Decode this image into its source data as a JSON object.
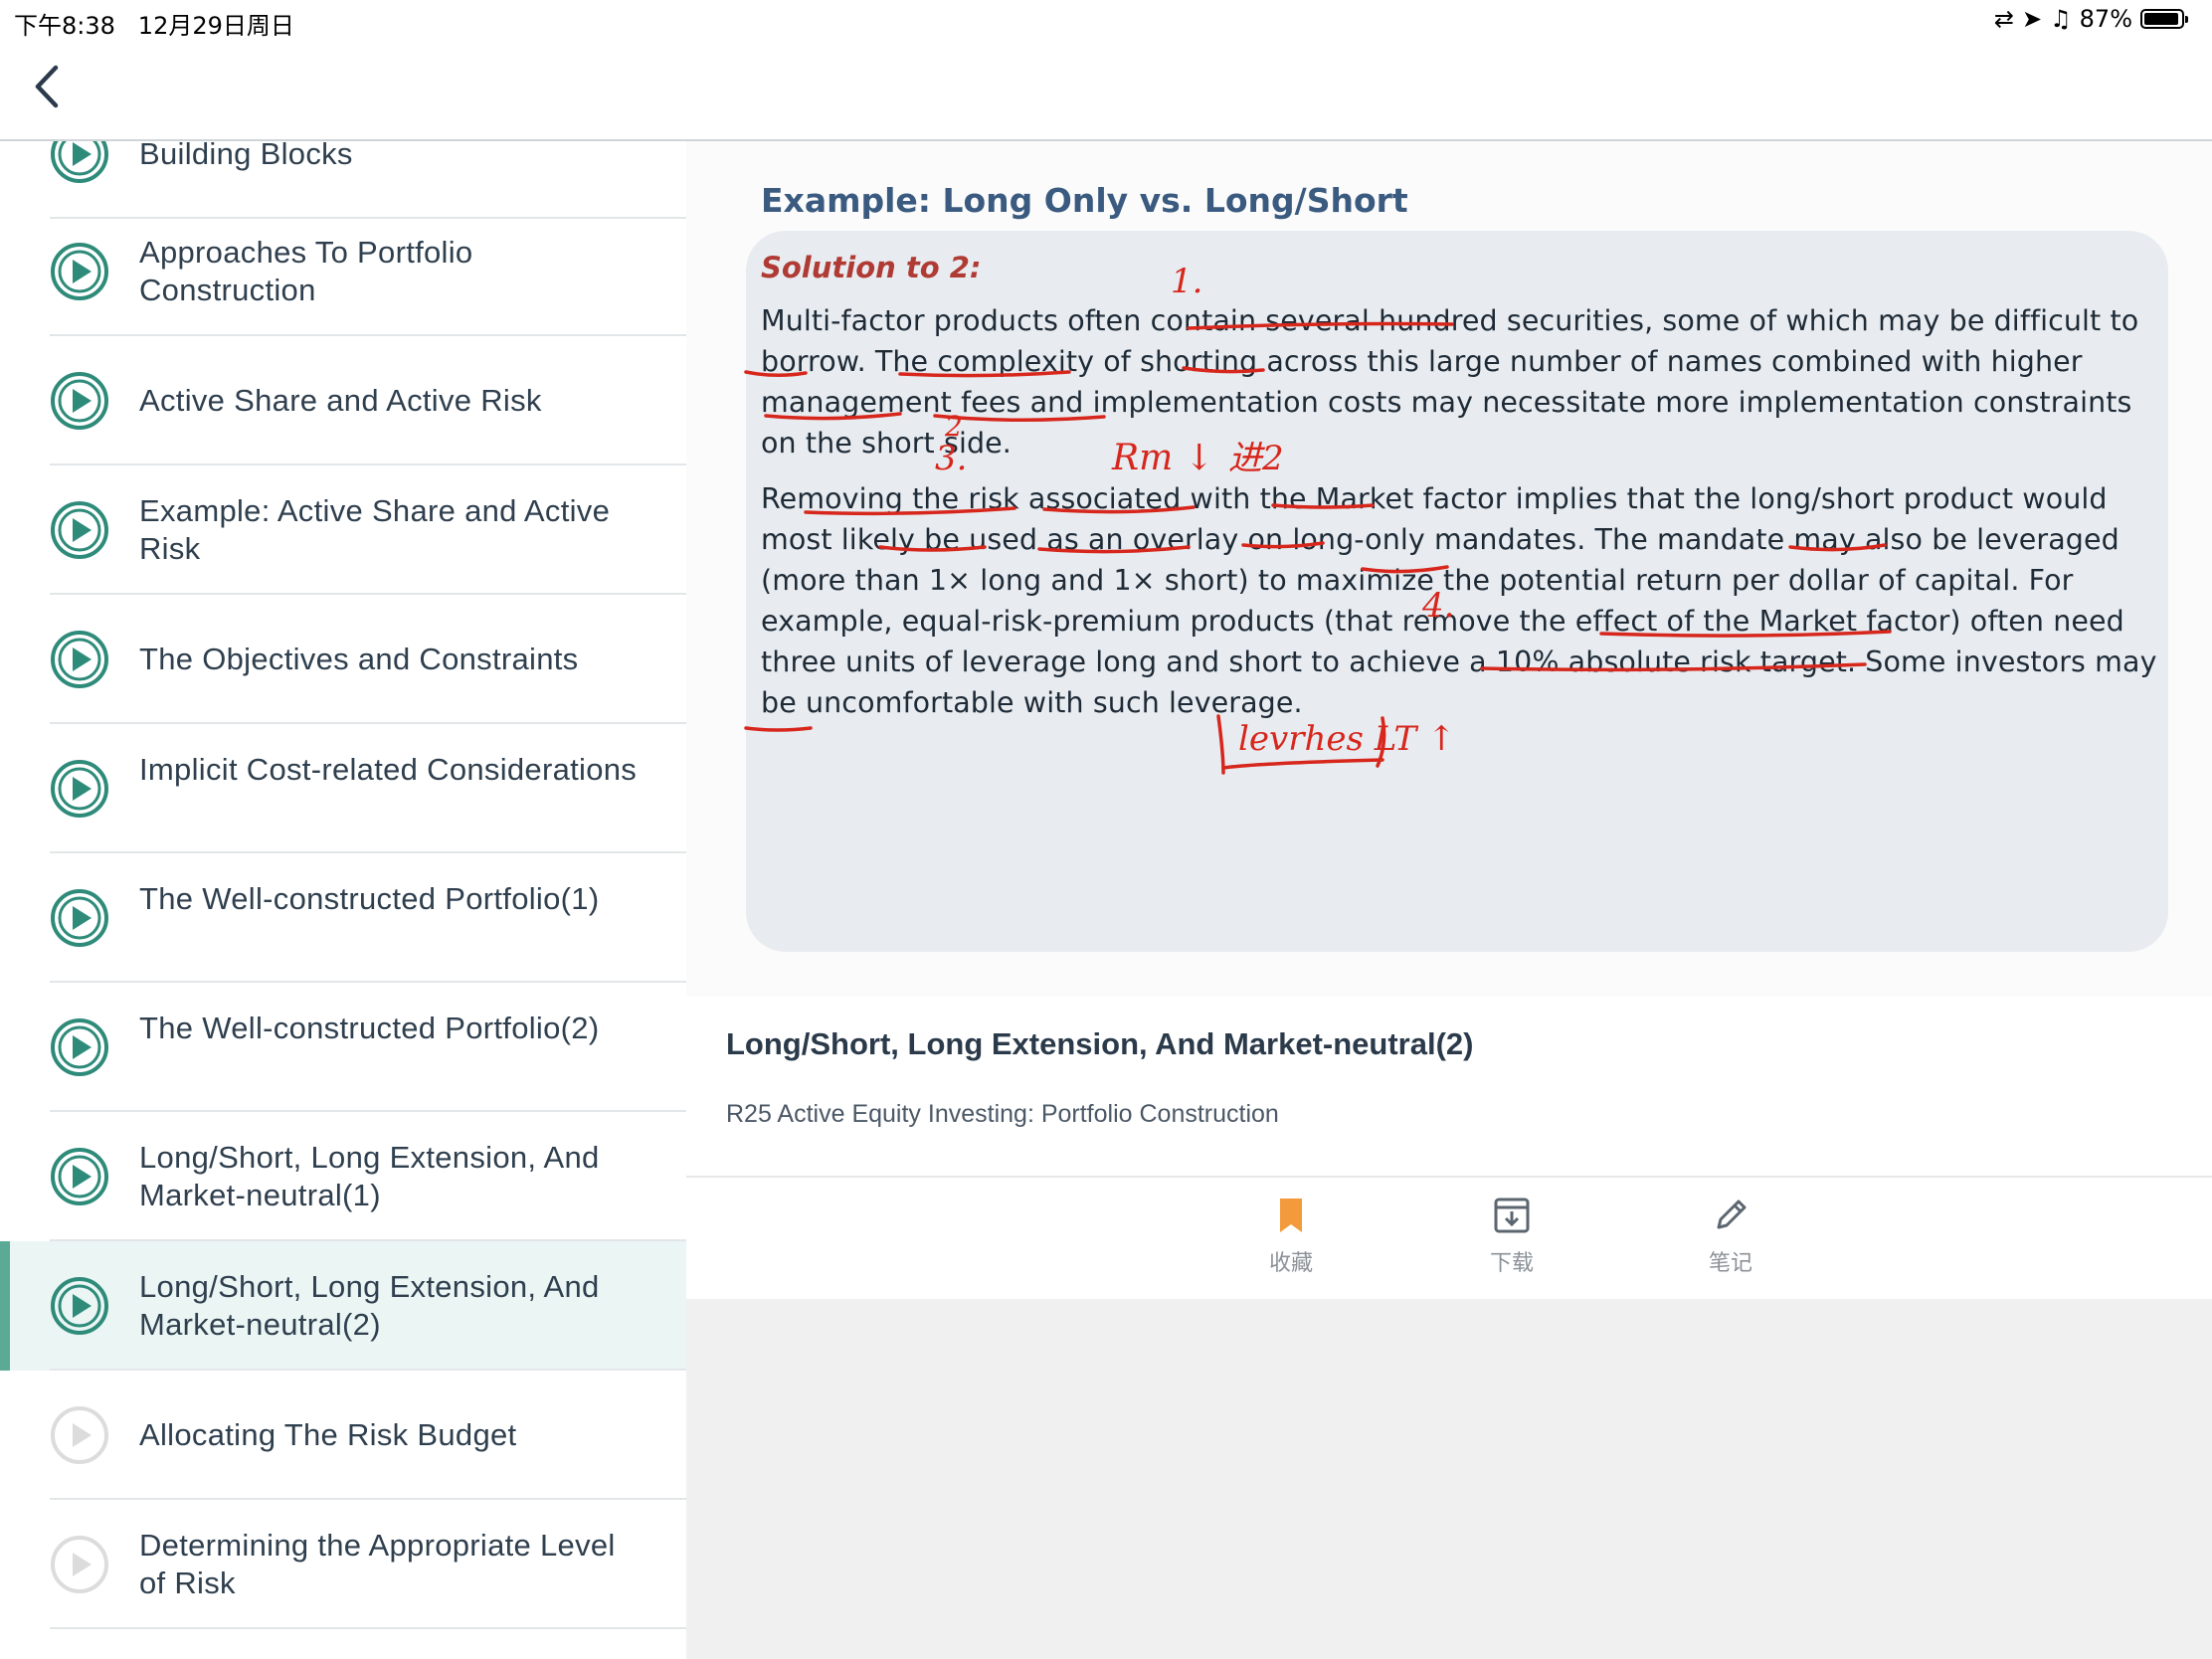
{
  "status": {
    "time": "下午8:38",
    "date": "12月29日周日",
    "battery": "87%",
    "battery_level": 0.87
  },
  "nav": {
    "back_label": "Back"
  },
  "sidebar": {
    "items": [
      {
        "label": "Building Blocks",
        "state": "done"
      },
      {
        "label": "Approaches To Portfolio Construction",
        "state": "done"
      },
      {
        "label": "Active Share and Active Risk",
        "state": "done"
      },
      {
        "label": "Example: Active Share and Active Risk",
        "state": "done"
      },
      {
        "label": "The Objectives and Constraints",
        "state": "done"
      },
      {
        "label": "Implicit Cost-related Considerations",
        "state": "done"
      },
      {
        "label": "The Well-constructed Portfolio(1)",
        "state": "done"
      },
      {
        "label": "The Well-constructed Portfolio(2)",
        "state": "done"
      },
      {
        "label": "Long/Short, Long Extension, And Market-neutral(1)",
        "state": "done"
      },
      {
        "label": "Long/Short, Long Extension, And Market-neutral(2)",
        "state": "active"
      },
      {
        "label": "Allocating The Risk Budget",
        "state": "locked"
      },
      {
        "label": "Determining the Appropriate Level of Risk",
        "state": "locked"
      }
    ]
  },
  "slide": {
    "title": "Example:  Long Only vs. Long/Short",
    "solution_title": "Solution to 2:",
    "para1": "Multi-factor products often contain several hundred securities, some of which may be difficult to borrow. The complexity of shorting across this large number of names combined with higher management fees and implementation costs may necessitate more implementation constraints on the short side.",
    "para2": "Removing the risk associated with the Market factor implies that the long/short product would most likely be used as an overlay on long-only mandates. The mandate may also be leveraged (more than 1× long and 1× short) to maximize the potential return per dollar of capital. For example, equal-risk-premium products (that remove the effect of the Market factor) often need three units of leverage long and short to achieve a 10% absolute risk target. Some investors may be uncomfortable with such leverage."
  },
  "lesson": {
    "title": "Long/Short, Long Extension, And Market-neutral(2)",
    "subtitle": "R25 Active Equity Investing: Portfolio Construction"
  },
  "toolbar": {
    "favorite": "收藏",
    "download": "下载",
    "notes": "笔记"
  },
  "colors": {
    "accent_teal": "#2e8b7a",
    "active_bar": "#5aaa96",
    "favorite_orange": "#f29a3c",
    "annotation_red": "#d7261c"
  }
}
